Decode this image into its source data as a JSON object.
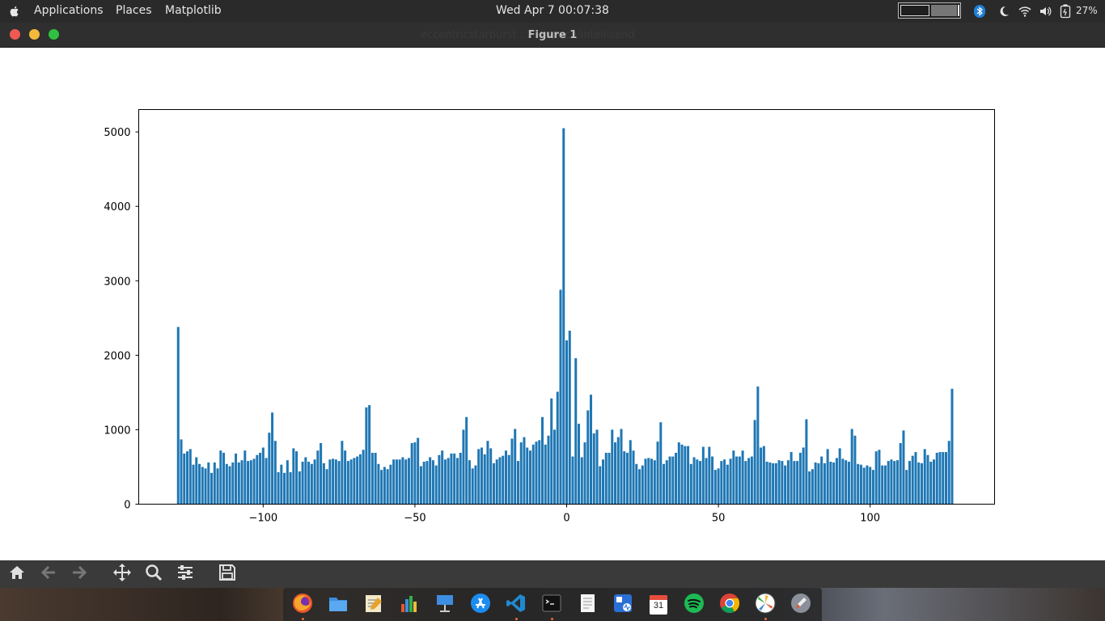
{
  "topbar": {
    "menus": [
      "Applications",
      "Places",
      "Matplotlib"
    ],
    "clock": "Wed Apr 7  00:07:38",
    "battery_percent": "27%",
    "battery_level": 0.27
  },
  "window": {
    "title": "Figure 1",
    "background_text": "eccentricstarburst . . . kspace/intellisend"
  },
  "colors": {
    "bar": "#1f77b4",
    "close": "#ee5a52",
    "minimize": "#f2b93b",
    "maximize": "#2fc13f"
  },
  "toolbar": {
    "buttons": [
      "home-icon",
      "back-icon",
      "forward-icon",
      "pan-icon",
      "zoom-icon",
      "configure-subplots-icon",
      "save-icon"
    ]
  },
  "dock": {
    "apps": [
      "firefox-icon",
      "files-icon",
      "text-editor-icon",
      "charts-icon",
      "keynote-icon",
      "app-store-icon",
      "vscode-icon",
      "terminal-icon",
      "notes-icon",
      "system-monitor-icon",
      "calendar-icon",
      "spotify-icon",
      "chrome-icon",
      "matplotlib-icon",
      "launchpad-icon"
    ],
    "calendar_day": "31"
  },
  "chart_data": {
    "type": "bar",
    "title": "",
    "xlabel": "",
    "ylabel": "",
    "xlim": [
      -141,
      141
    ],
    "ylim": [
      0,
      5300
    ],
    "xticks": [
      -100,
      -50,
      0,
      50,
      100
    ],
    "yticks": [
      0,
      1000,
      2000,
      3000,
      4000,
      5000
    ],
    "xtick_labels": [
      "−100",
      "−50",
      "0",
      "50",
      "100"
    ],
    "ytick_labels": [
      "0",
      "1000",
      "2000",
      "3000",
      "4000",
      "5000"
    ],
    "x_start": -128,
    "values": [
      2380,
      870,
      680,
      710,
      740,
      530,
      630,
      540,
      500,
      480,
      560,
      420,
      560,
      480,
      720,
      690,
      540,
      510,
      560,
      680,
      560,
      590,
      720,
      580,
      590,
      610,
      660,
      690,
      760,
      620,
      960,
      1230,
      850,
      430,
      530,
      420,
      590,
      430,
      750,
      710,
      440,
      570,
      630,
      570,
      540,
      600,
      720,
      820,
      550,
      470,
      600,
      610,
      600,
      580,
      850,
      720,
      580,
      600,
      620,
      640,
      670,
      730,
      1300,
      1330,
      690,
      690,
      540,
      460,
      500,
      470,
      530,
      600,
      600,
      600,
      630,
      600,
      620,
      820,
      830,
      890,
      510,
      570,
      580,
      630,
      590,
      520,
      660,
      720,
      600,
      620,
      680,
      680,
      620,
      690,
      1000,
      1170,
      590,
      480,
      520,
      740,
      760,
      670,
      850,
      750,
      550,
      600,
      630,
      650,
      720,
      660,
      880,
      1010,
      580,
      830,
      900,
      760,
      720,
      800,
      840,
      860,
      1170,
      800,
      920,
      1420,
      1000,
      1510,
      2880,
      5050,
      2200,
      2330,
      640,
      1960,
      1080,
      630,
      830,
      1260,
      1470,
      950,
      1000,
      510,
      600,
      690,
      690,
      1000,
      830,
      900,
      1010,
      710,
      690,
      860,
      720,
      540,
      470,
      520,
      610,
      620,
      610,
      590,
      840,
      1100,
      540,
      590,
      640,
      640,
      690,
      830,
      800,
      780,
      780,
      540,
      630,
      600,
      580,
      770,
      620,
      770,
      640,
      460,
      480,
      580,
      600,
      530,
      610,
      720,
      640,
      640,
      720,
      580,
      620,
      640,
      1130,
      1580,
      760,
      780,
      570,
      560,
      550,
      550,
      590,
      580,
      520,
      590,
      700,
      580,
      580,
      690,
      760,
      1140,
      440,
      470,
      560,
      550,
      640,
      550,
      740,
      570,
      560,
      620,
      750,
      610,
      590,
      570,
      1010,
      920,
      540,
      530,
      490,
      520,
      500,
      460,
      710,
      730,
      520,
      520,
      580,
      600,
      580,
      590,
      820,
      990,
      460,
      580,
      650,
      700,
      560,
      550,
      740,
      660,
      570,
      600,
      690,
      700,
      700,
      700,
      850,
      1550
    ]
  }
}
